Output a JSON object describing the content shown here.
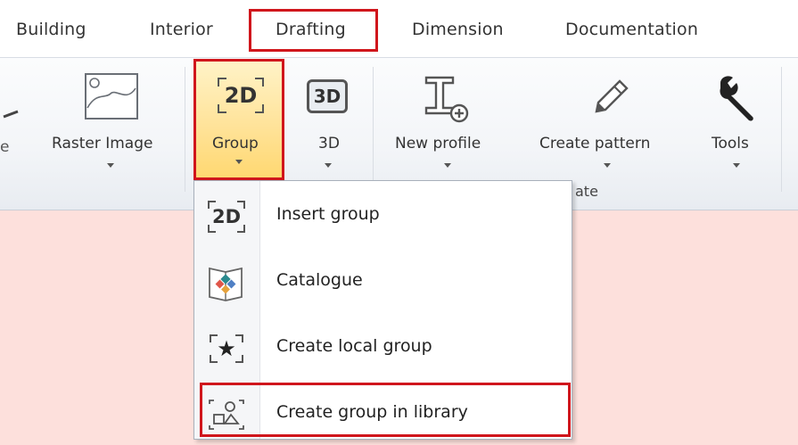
{
  "tabs": [
    {
      "label": "Building"
    },
    {
      "label": "Interior"
    },
    {
      "label": "Drafting",
      "active": true
    },
    {
      "label": "Dimension"
    },
    {
      "label": "Documentation"
    }
  ],
  "ribbon": {
    "raster_label": "Raster Image",
    "group_label": "Group",
    "threed_label": "3D",
    "new_profile_label": "New profile",
    "create_pattern_label": "Create pattern",
    "tools_label": "Tools",
    "icon_2d_text": "2D",
    "icon_3d_text": "3D",
    "partial_left_label": "e",
    "caption_partial": "ate"
  },
  "menu": {
    "items": [
      {
        "label": "Insert group",
        "icon": "2d-group-icon",
        "icon_text": "2D"
      },
      {
        "label": "Catalogue",
        "icon": "catalogue-icon"
      },
      {
        "label": "Create local group",
        "icon": "star-group-icon",
        "icon_text": "★"
      },
      {
        "label": "Create group in library",
        "icon": "library-group-icon",
        "highlighted": true
      }
    ]
  },
  "colors": {
    "highlight_border": "#d0161c",
    "button_active": "#ffe39a",
    "canvas": "#fde0dc"
  }
}
